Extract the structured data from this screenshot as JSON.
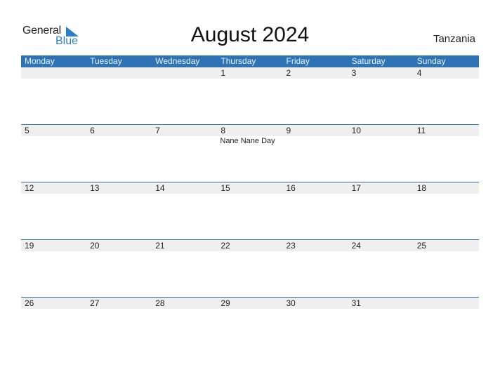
{
  "logo": {
    "general": "General",
    "blue": "Blue",
    "accent_color": "#2a7fc9"
  },
  "header": {
    "title": "August 2024",
    "country": "Tanzania",
    "bar_color": "#2e74b5"
  },
  "weekdays": [
    "Monday",
    "Tuesday",
    "Wednesday",
    "Thursday",
    "Friday",
    "Saturday",
    "Sunday"
  ],
  "weeks": [
    {
      "days": [
        "",
        "",
        "",
        "1",
        "2",
        "3",
        "4"
      ],
      "events": [
        "",
        "",
        "",
        "",
        "",
        "",
        ""
      ]
    },
    {
      "days": [
        "5",
        "6",
        "7",
        "8",
        "9",
        "10",
        "11"
      ],
      "events": [
        "",
        "",
        "",
        "Nane Nane Day",
        "",
        "",
        ""
      ]
    },
    {
      "days": [
        "12",
        "13",
        "14",
        "15",
        "16",
        "17",
        "18"
      ],
      "events": [
        "",
        "",
        "",
        "",
        "",
        "",
        ""
      ]
    },
    {
      "days": [
        "19",
        "20",
        "21",
        "22",
        "23",
        "24",
        "25"
      ],
      "events": [
        "",
        "",
        "",
        "",
        "",
        "",
        ""
      ]
    },
    {
      "days": [
        "26",
        "27",
        "28",
        "29",
        "30",
        "31",
        ""
      ],
      "events": [
        "",
        "",
        "",
        "",
        "",
        "",
        ""
      ]
    }
  ]
}
